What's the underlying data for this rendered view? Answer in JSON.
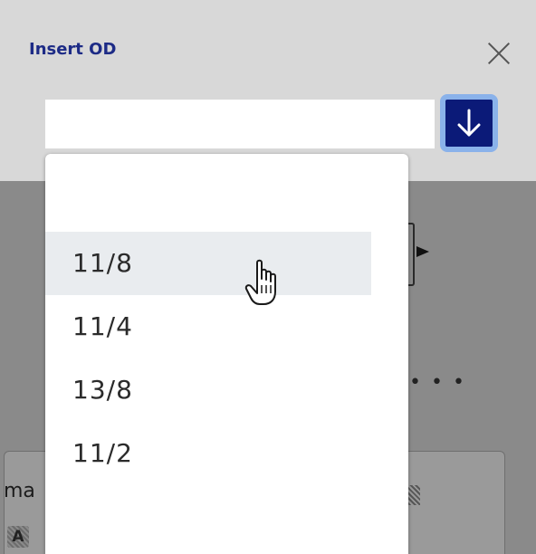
{
  "dialog": {
    "title": "Insert OD",
    "close_icon": "close-icon",
    "input_value": "",
    "dropdown_icon": "arrow-down-icon",
    "accent": "#0b1a78"
  },
  "dropdown": {
    "options": [
      {
        "label": "",
        "hovered": false
      },
      {
        "label": "11/8",
        "hovered": true
      },
      {
        "label": "11/4",
        "hovered": false
      },
      {
        "label": "13/8",
        "hovered": false
      },
      {
        "label": "11/2",
        "hovered": false
      }
    ]
  },
  "background": {
    "partial_text": "ma",
    "icon_letter": "A"
  }
}
